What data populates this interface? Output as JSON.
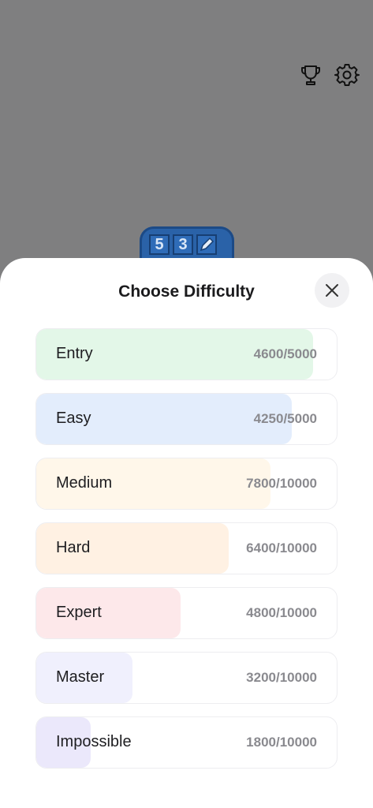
{
  "sheet": {
    "title": "Choose Difficulty"
  },
  "app_logo": {
    "digits": [
      "5",
      "3"
    ]
  },
  "levels": [
    {
      "name": "Entry",
      "score": "4600/5000",
      "progress": 0.92,
      "fill_color": "#e3f7e8"
    },
    {
      "name": "Easy",
      "score": "4250/5000",
      "progress": 0.85,
      "fill_color": "#e3edfc"
    },
    {
      "name": "Medium",
      "score": "7800/10000",
      "progress": 0.78,
      "fill_color": "#fff7ea"
    },
    {
      "name": "Hard",
      "score": "6400/10000",
      "progress": 0.64,
      "fill_color": "#fff1e3"
    },
    {
      "name": "Expert",
      "score": "4800/10000",
      "progress": 0.48,
      "fill_color": "#fde8ea"
    },
    {
      "name": "Master",
      "score": "3200/10000",
      "progress": 0.32,
      "fill_color": "#f0f0fd"
    },
    {
      "name": "Impossible",
      "score": "1800/10000",
      "progress": 0.18,
      "fill_color": "#ebe8fb"
    }
  ],
  "icons": {
    "trophy": "trophy-icon",
    "settings": "gear-icon",
    "close": "close-icon"
  }
}
